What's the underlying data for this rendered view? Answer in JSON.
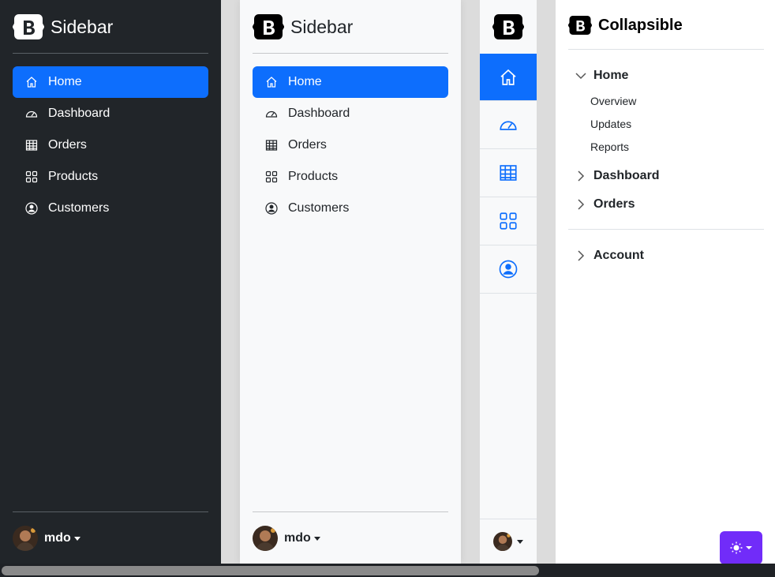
{
  "dark_sidebar": {
    "brand": "Sidebar",
    "items": [
      {
        "label": "Home",
        "icon": "home-icon",
        "active": true
      },
      {
        "label": "Dashboard",
        "icon": "speedometer-icon"
      },
      {
        "label": "Orders",
        "icon": "table-icon"
      },
      {
        "label": "Products",
        "icon": "grid-icon"
      },
      {
        "label": "Customers",
        "icon": "person-circle-icon"
      }
    ],
    "user": "mdo"
  },
  "light_sidebar": {
    "brand": "Sidebar",
    "items": [
      {
        "label": "Home",
        "icon": "home-icon",
        "active": true
      },
      {
        "label": "Dashboard",
        "icon": "speedometer-icon"
      },
      {
        "label": "Orders",
        "icon": "table-icon"
      },
      {
        "label": "Products",
        "icon": "grid-icon"
      },
      {
        "label": "Customers",
        "icon": "person-circle-icon"
      }
    ],
    "user": "mdo"
  },
  "icon_sidebar": {
    "items": [
      "home-icon",
      "speedometer-icon",
      "table-icon",
      "grid-icon",
      "person-circle-icon"
    ]
  },
  "collapsible": {
    "brand": "Collapsible",
    "sections": [
      {
        "label": "Home",
        "expanded": true,
        "items": [
          "Overview",
          "Updates",
          "Reports"
        ]
      },
      {
        "label": "Dashboard",
        "expanded": false
      },
      {
        "label": "Orders",
        "expanded": false
      }
    ],
    "account": "Account"
  },
  "colors": {
    "primary": "#0d6efd",
    "dark_bg": "#212529",
    "theme_button": "#712cf9"
  }
}
